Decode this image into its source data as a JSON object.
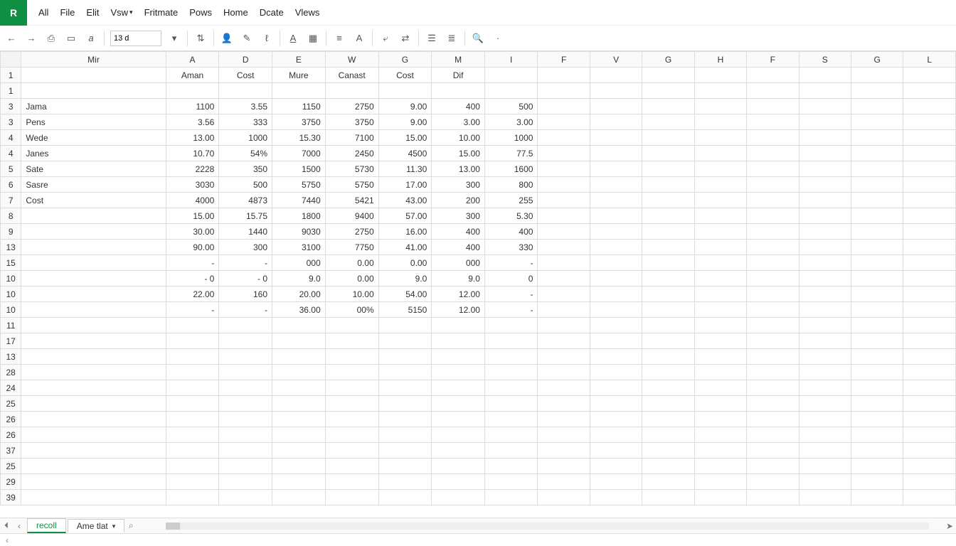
{
  "app": {
    "logo": "R"
  },
  "menu": [
    "All",
    "File",
    "Elit",
    "Vsw",
    "Fritmate",
    "Pows",
    "Home",
    "Dcate",
    "Vlews"
  ],
  "toolbar": {
    "font_value": "13 d"
  },
  "columns": [
    "Mir",
    "A",
    "D",
    "E",
    "W",
    "G",
    "M",
    "I",
    "F",
    "V",
    "G",
    "H",
    "F",
    "S",
    "G",
    "L"
  ],
  "row_numbers": [
    "1",
    "1",
    "3",
    "3",
    "4",
    "4",
    "5",
    "6",
    "7",
    "8",
    "9",
    "13",
    "15",
    "10",
    "10",
    "10",
    "11",
    "17",
    "13",
    "28",
    "24",
    "25",
    "26",
    "26",
    "37",
    "25",
    "29",
    "39"
  ],
  "headers_row": [
    "",
    "Aman",
    "Cost",
    "Mure",
    "Canast",
    "Cost",
    "Dif",
    "",
    "",
    "",
    "",
    "",
    "",
    "",
    "",
    ""
  ],
  "data_rows": [
    [
      "",
      "",
      "",
      "",
      "",
      "",
      "",
      "",
      "",
      "",
      "",
      "",
      "",
      "",
      "",
      ""
    ],
    [
      "Jama",
      "1100",
      "3.55",
      "1150",
      "2750",
      "9.00",
      "400",
      "500",
      "",
      "",
      "",
      "",
      "",
      "",
      "",
      ""
    ],
    [
      "Pens",
      "3.56",
      "333",
      "3750",
      "3750",
      "9.00",
      "3.00",
      "3.00",
      "",
      "",
      "",
      "",
      "",
      "",
      "",
      ""
    ],
    [
      "Wede",
      "13.00",
      "1000",
      "15.30",
      "7100",
      "15.00",
      "10.00",
      "1000",
      "",
      "",
      "",
      "",
      "",
      "",
      "",
      ""
    ],
    [
      "Janes",
      "10.70",
      "54%",
      "7000",
      "2450",
      "4500",
      "15.00",
      "77.5",
      "",
      "",
      "",
      "",
      "",
      "",
      "",
      ""
    ],
    [
      "Sate",
      "2228",
      "350",
      "1500",
      "5730",
      "11.30",
      "13.00",
      "1600",
      "",
      "",
      "",
      "",
      "",
      "",
      "",
      ""
    ],
    [
      "Sasre",
      "3030",
      "500",
      "5750",
      "5750",
      "17.00",
      "300",
      "800",
      "",
      "",
      "",
      "",
      "",
      "",
      "",
      ""
    ],
    [
      "Cost",
      "4000",
      "4873",
      "7440",
      "5421",
      "43.00",
      "200",
      "255",
      "",
      "",
      "",
      "",
      "",
      "",
      "",
      ""
    ],
    [
      "",
      "15.00",
      "15.75",
      "1800",
      "9400",
      "57.00",
      "300",
      "5.30",
      "",
      "",
      "",
      "",
      "",
      "",
      "",
      ""
    ],
    [
      "",
      "30.00",
      "1440",
      "9030",
      "2750",
      "16.00",
      "400",
      "400",
      "",
      "",
      "",
      "",
      "",
      "",
      "",
      ""
    ],
    [
      "",
      "90.00",
      "300",
      "3100",
      "7750",
      "41.00",
      "400",
      "330",
      "",
      "",
      "",
      "",
      "",
      "",
      "",
      ""
    ],
    [
      "",
      "-",
      "-",
      "000",
      "0.00",
      "0.00",
      "000",
      "-",
      "",
      "",
      "",
      "",
      "",
      "",
      "",
      ""
    ],
    [
      "",
      "- 0",
      "- 0",
      "9.0",
      "0.00",
      "9.0",
      "9.0",
      "0",
      "",
      "",
      "",
      "",
      "",
      "",
      "",
      ""
    ],
    [
      "",
      "22.00",
      "160",
      "20.00",
      "10.00",
      "54.00",
      "12.00",
      "-",
      "",
      "",
      "",
      "",
      "",
      "",
      "",
      ""
    ],
    [
      "",
      "-",
      "-",
      "36.00",
      "00%",
      "5150",
      "12.00",
      "-",
      "",
      "",
      "",
      "",
      "",
      "",
      "",
      ""
    ],
    [
      "",
      "",
      "",
      "",
      "",
      "",
      "",
      "",
      "",
      "",
      "",
      "",
      "",
      "",
      "",
      ""
    ],
    [
      "",
      "",
      "",
      "",
      "",
      "",
      "",
      "",
      "",
      "",
      "",
      "",
      "",
      "",
      "",
      ""
    ],
    [
      "",
      "",
      "",
      "",
      "",
      "",
      "",
      "",
      "",
      "",
      "",
      "",
      "",
      "",
      "",
      ""
    ],
    [
      "",
      "",
      "",
      "",
      "",
      "",
      "",
      "",
      "",
      "",
      "",
      "",
      "",
      "",
      "",
      ""
    ],
    [
      "",
      "",
      "",
      "",
      "",
      "",
      "",
      "",
      "",
      "",
      "",
      "",
      "",
      "",
      "",
      ""
    ],
    [
      "",
      "",
      "",
      "",
      "",
      "",
      "",
      "",
      "",
      "",
      "",
      "",
      "",
      "",
      "",
      ""
    ],
    [
      "",
      "",
      "",
      "",
      "",
      "",
      "",
      "",
      "",
      "",
      "",
      "",
      "",
      "",
      "",
      ""
    ],
    [
      "",
      "",
      "",
      "",
      "",
      "",
      "",
      "",
      "",
      "",
      "",
      "",
      "",
      "",
      "",
      ""
    ],
    [
      "",
      "",
      "",
      "",
      "",
      "",
      "",
      "",
      "",
      "",
      "",
      "",
      "",
      "",
      "",
      ""
    ],
    [
      "",
      "",
      "",
      "",
      "",
      "",
      "",
      "",
      "",
      "",
      "",
      "",
      "",
      "",
      "",
      ""
    ],
    [
      "",
      "",
      "",
      "",
      "",
      "",
      "",
      "",
      "",
      "",
      "",
      "",
      "",
      "",
      "",
      ""
    ],
    [
      "",
      "",
      "",
      "",
      "",
      "",
      "",
      "",
      "",
      "",
      "",
      "",
      "",
      "",
      "",
      ""
    ]
  ],
  "tabs": {
    "active": "recoll",
    "other": "Ame tlat"
  },
  "chart_data": {
    "type": "table",
    "title": "",
    "columns": [
      "",
      "Aman",
      "Cost",
      "Mure",
      "Canast",
      "Cost",
      "Dif",
      ""
    ],
    "rows": [
      [
        "Jama",
        1100,
        3.55,
        1150,
        2750,
        9.0,
        400,
        500
      ],
      [
        "Pens",
        3.56,
        333,
        3750,
        3750,
        9.0,
        3.0,
        3.0
      ],
      [
        "Wede",
        13.0,
        1000,
        15.3,
        7100,
        15.0,
        10.0,
        1000
      ],
      [
        "Janes",
        10.7,
        "54%",
        7000,
        2450,
        4500,
        15.0,
        77.5
      ],
      [
        "Sate",
        2228,
        350,
        1500,
        5730,
        11.3,
        13.0,
        1600
      ],
      [
        "Sasre",
        3030,
        500,
        5750,
        5750,
        17.0,
        300,
        800
      ],
      [
        "Cost",
        4000,
        4873,
        7440,
        5421,
        43.0,
        200,
        255
      ],
      [
        "",
        15.0,
        15.75,
        1800,
        9400,
        57.0,
        300,
        5.3
      ],
      [
        "",
        30.0,
        1440,
        9030,
        2750,
        16.0,
        400,
        400
      ],
      [
        "",
        90.0,
        300,
        3100,
        7750,
        41.0,
        400,
        330
      ],
      [
        "",
        "-",
        "-",
        "000",
        0.0,
        0.0,
        "000",
        "-"
      ],
      [
        "",
        "- 0",
        "- 0",
        9.0,
        0.0,
        9.0,
        9.0,
        0
      ],
      [
        "",
        22.0,
        160,
        20.0,
        10.0,
        54.0,
        12.0,
        "-"
      ],
      [
        "",
        "-",
        "-",
        36.0,
        "00%",
        5150,
        12.0,
        "-"
      ]
    ]
  }
}
